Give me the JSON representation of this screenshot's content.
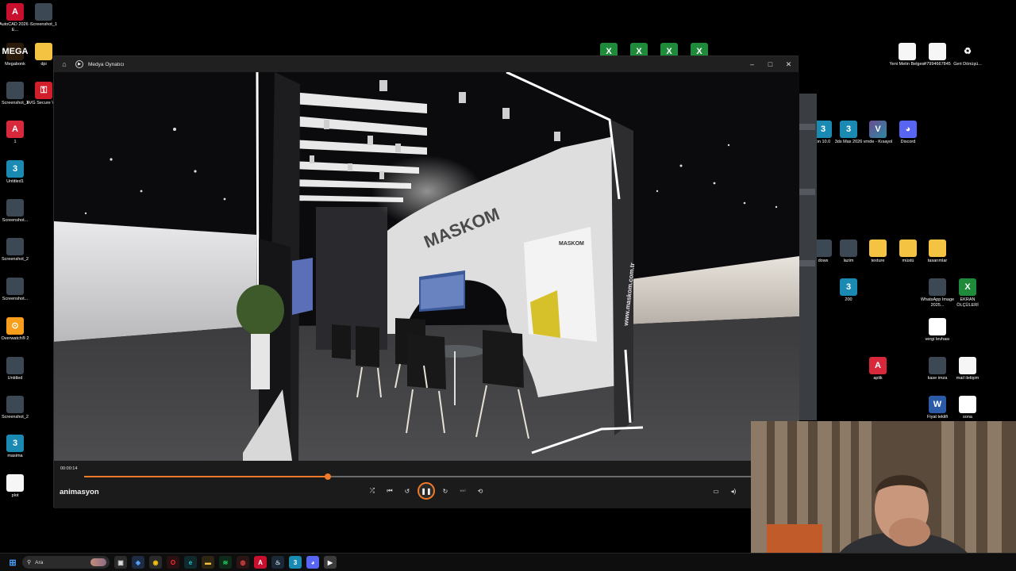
{
  "desktop": {
    "left_icons": [
      {
        "label": "AutoCAD 2026 - E...",
        "icon": "autocad-icon",
        "glyph": "A"
      },
      {
        "label": "Screenshot_1",
        "icon": "image-file-icon",
        "glyph": ""
      },
      {
        "label": "Megabonk",
        "icon": "megabonk-icon",
        "glyph": "MEGA"
      },
      {
        "label": "dpi",
        "icon": "folder-icon",
        "glyph": ""
      },
      {
        "label": "Screenshot_1",
        "icon": "image-file-icon",
        "glyph": ""
      },
      {
        "label": "AVG Secure VPN",
        "icon": "avg-vpn-icon",
        "glyph": "⚿"
      },
      {
        "label": "1",
        "icon": "frx-file-icon",
        "glyph": "A"
      },
      {
        "label": "Untitled1",
        "icon": "3dsmax-file-icon",
        "glyph": "3"
      },
      {
        "label": "Screenshot...",
        "icon": "image-file-icon",
        "glyph": ""
      },
      {
        "label": "Screenshot_2",
        "icon": "image-file-icon",
        "glyph": ""
      },
      {
        "label": "Screenshot...",
        "icon": "image-file-icon",
        "glyph": ""
      },
      {
        "label": "Overwatch® 2",
        "icon": "overwatch-icon",
        "glyph": "⊙"
      },
      {
        "label": "Untitled",
        "icon": "image-file-icon",
        "glyph": ""
      },
      {
        "label": "Screenshot_2",
        "icon": "image-file-icon",
        "glyph": ""
      },
      {
        "label": "masima",
        "icon": "3dsmax-file-icon",
        "glyph": "3"
      },
      {
        "label": "plot",
        "icon": "document-file-icon",
        "glyph": ""
      }
    ],
    "right_icons": [
      {
        "label": "Yeni Metin Belgesi",
        "icon": "text-file-icon",
        "glyph": ""
      },
      {
        "label": "#7994667845",
        "icon": "text-file-icon",
        "glyph": ""
      },
      {
        "label": "Geri Dönüşü...",
        "icon": "recycle-bin-icon",
        "glyph": "♻"
      },
      {
        "label": "on 10.0",
        "icon": "3dsmax-icon",
        "glyph": "3"
      },
      {
        "label": "3ds Max 2026",
        "icon": "3dsmax-icon",
        "glyph": "3"
      },
      {
        "label": "vrnde - Kısayol",
        "icon": "vray-shortcut-icon",
        "glyph": "V"
      },
      {
        "label": "Discord",
        "icon": "discord-icon",
        "glyph": "◕"
      },
      {
        "label": "dows",
        "icon": "image-file-icon",
        "glyph": ""
      },
      {
        "label": "lazim",
        "icon": "image-file-icon",
        "glyph": ""
      },
      {
        "label": "texture",
        "icon": "folder-icon",
        "glyph": ""
      },
      {
        "label": "müstü",
        "icon": "folder-icon",
        "glyph": ""
      },
      {
        "label": "tasarımlar",
        "icon": "folder-icon",
        "glyph": ""
      },
      {
        "label": "200",
        "icon": "3dsmax-file-icon",
        "glyph": "3"
      },
      {
        "label": "WhatsApp Image 2025...",
        "icon": "image-file-icon",
        "glyph": ""
      },
      {
        "label": "EKRAN ÖLÇÜLERİ",
        "icon": "excel-file-icon",
        "glyph": "X"
      },
      {
        "label": "vergi levhası",
        "icon": "pdf-file-icon",
        "glyph": "PDF"
      },
      {
        "label": "aplik",
        "icon": "frx-file-icon",
        "glyph": "A"
      },
      {
        "label": "kase imza",
        "icon": "image-file-icon",
        "glyph": ""
      },
      {
        "label": "mail iletişim",
        "icon": "text-file-icon",
        "glyph": ""
      },
      {
        "label": "Fiyat teklifi",
        "icon": "word-file-icon",
        "glyph": "W"
      },
      {
        "label": "sona",
        "icon": "pdf-file-icon",
        "glyph": "PDF"
      }
    ],
    "top_excel_icons": [
      "X",
      "X",
      "X",
      "X"
    ]
  },
  "player": {
    "window_title": "Medya Oynatıcı",
    "home_glyph": "⌂",
    "window_controls": {
      "minimize": "–",
      "maximize": "□",
      "close": "✕"
    },
    "scene": {
      "brand": "MASKOM",
      "website": "www.maskom.com.tr",
      "poster_brand": "MASKOM"
    },
    "timecode": "00:00:14",
    "progress": 0.365,
    "media_title": "animasyon",
    "controls": {
      "shuffle": "⤮",
      "previous": "⏮",
      "rewind": "↺",
      "play_pause": "❚❚",
      "forward": "↻",
      "next": "⏭",
      "repeat": "⟲"
    },
    "right_controls": {
      "miniplayer": "▭",
      "volume": "◂)"
    }
  },
  "taskbar": {
    "start_glyph": "⊞",
    "search_placeholder": "Ara",
    "apps": [
      {
        "name": "task-view",
        "glyph": "▣",
        "color": "#dcdcdc",
        "bg": "#2b2b2b"
      },
      {
        "name": "app-blue",
        "glyph": "◈",
        "color": "#5aa3ff",
        "bg": "#1d2b44"
      },
      {
        "name": "chrome",
        "glyph": "◉",
        "color": "#f4c20d",
        "bg": "#2a2a2a"
      },
      {
        "name": "opera",
        "glyph": "O",
        "color": "#ff2a37",
        "bg": "#2a1010"
      },
      {
        "name": "edge",
        "glyph": "e",
        "color": "#27c0c8",
        "bg": "#10292c"
      },
      {
        "name": "file-explorer",
        "glyph": "▬",
        "color": "#f3c341",
        "bg": "#2c2613"
      },
      {
        "name": "spotify",
        "glyph": "≋",
        "color": "#1ed760",
        "bg": "#0f2a18"
      },
      {
        "name": "recorder",
        "glyph": "◍",
        "color": "#e04040",
        "bg": "#2a1414"
      },
      {
        "name": "autocad",
        "glyph": "A",
        "color": "#ffffff",
        "bg": "#c8102e"
      },
      {
        "name": "steam",
        "glyph": "♨",
        "color": "#c7d5e0",
        "bg": "#1b2838"
      },
      {
        "name": "3dsmax",
        "glyph": "3",
        "color": "#ffffff",
        "bg": "#1a8ab3"
      },
      {
        "name": "discord",
        "glyph": "◕",
        "color": "#ffffff",
        "bg": "#5865f2"
      },
      {
        "name": "media-player",
        "glyph": "▶",
        "color": "#ffffff",
        "bg": "#3b3b3b"
      }
    ]
  }
}
